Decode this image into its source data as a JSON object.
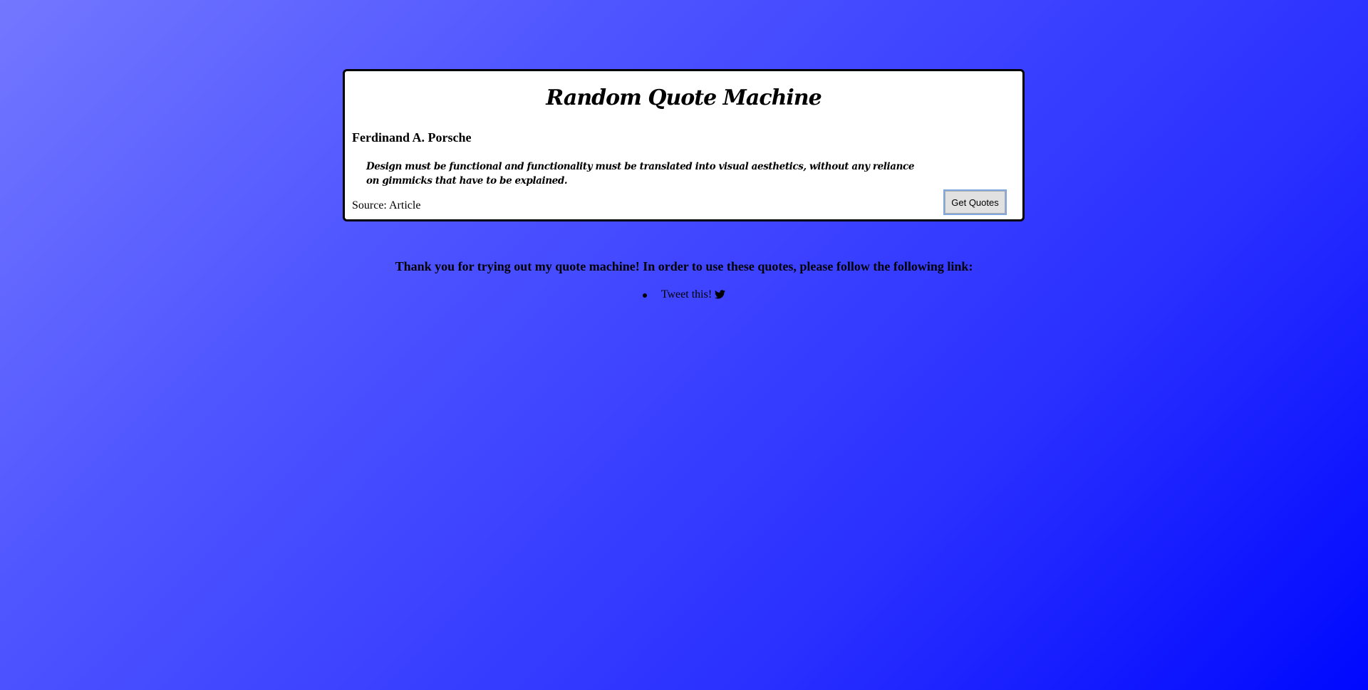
{
  "card": {
    "title": "Random Quote Machine",
    "author": "Ferdinand A. Porsche",
    "quote": "Design must be functional and functionality must be translated into visual aesthetics, without any reliance on gimmicks that have to be explained.",
    "source": "Source: Article",
    "button_label": "Get Quotes"
  },
  "footer": {
    "message": "Thank you for trying out my quote machine! In order to use these quotes, please follow the following link:",
    "links": [
      {
        "label": "Tweet this!",
        "icon": "twitter-icon"
      }
    ]
  },
  "colors": {
    "background_start": "#7377ff",
    "background_end": "#0008ff",
    "card_background": "#ffffff",
    "card_border": "#000000"
  }
}
